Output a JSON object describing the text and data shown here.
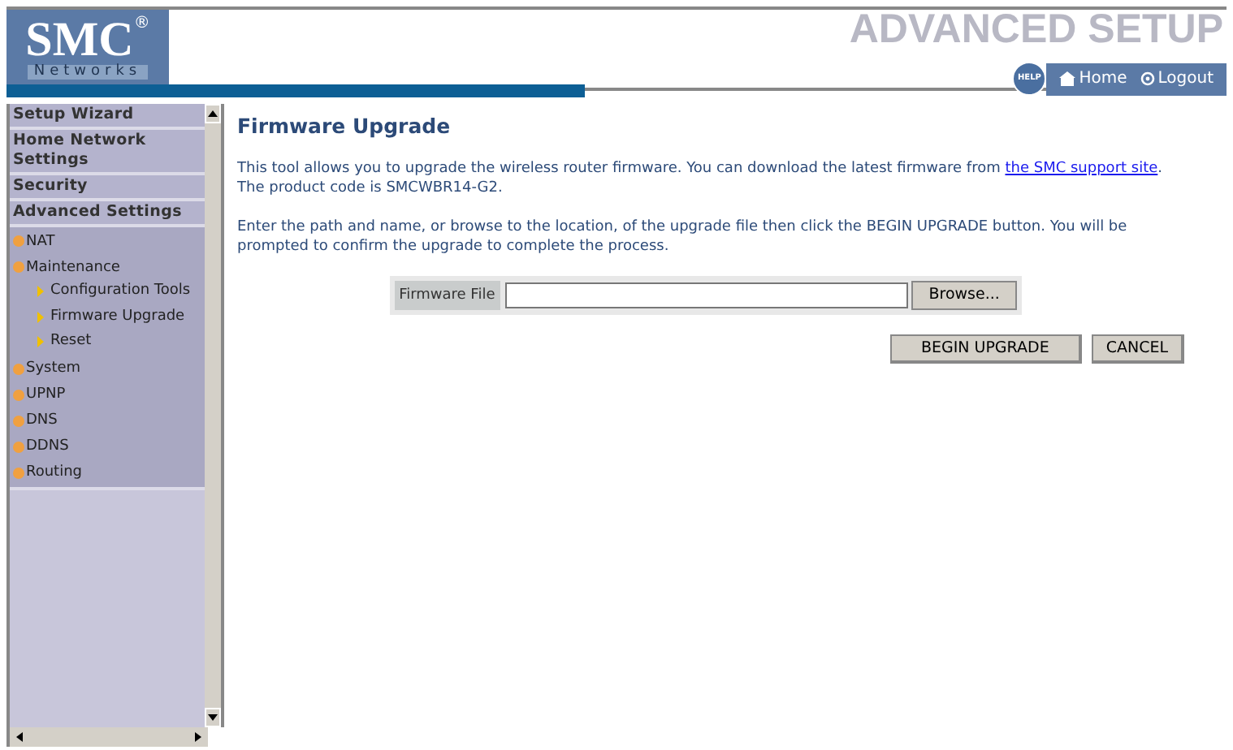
{
  "header": {
    "logo": "SMC",
    "logo_mark": "®",
    "logo_sub": "Networks",
    "title": "ADVANCED SETUP",
    "links": [
      {
        "label": "Home",
        "kind": "home"
      },
      {
        "label": "Logout",
        "kind": "logout"
      }
    ],
    "help_label": "HELP"
  },
  "sidebar": {
    "sections": [
      {
        "label": "Setup Wizard"
      },
      {
        "label": "Home Network Settings"
      },
      {
        "label": "Security"
      },
      {
        "label": "Advanced Settings"
      }
    ],
    "items": [
      {
        "label": "NAT"
      },
      {
        "label": "Maintenance",
        "children": [
          {
            "label": "Configuration Tools"
          },
          {
            "label": "Firmware Upgrade"
          },
          {
            "label": "Reset"
          }
        ]
      },
      {
        "label": "System"
      },
      {
        "label": "UPNP"
      },
      {
        "label": "DNS"
      },
      {
        "label": "DDNS"
      },
      {
        "label": "Routing"
      }
    ]
  },
  "main": {
    "heading": "Firmware Upgrade",
    "intro_before": "This tool allows you to upgrade the wireless router firmware. You can download the latest firmware from ",
    "intro_link": "the SMC support site",
    "intro_after": ". The product code is SMCWBR14-G2.",
    "instructions": "Enter the path and name, or browse to the location, of the upgrade file then click the BEGIN UPGRADE button. You will be prompted to confirm the upgrade to complete the process.",
    "file_label": "Firmware File",
    "browse_button": "Browse...",
    "buttons": [
      "BEGIN UPGRADE",
      "CANCEL"
    ]
  }
}
